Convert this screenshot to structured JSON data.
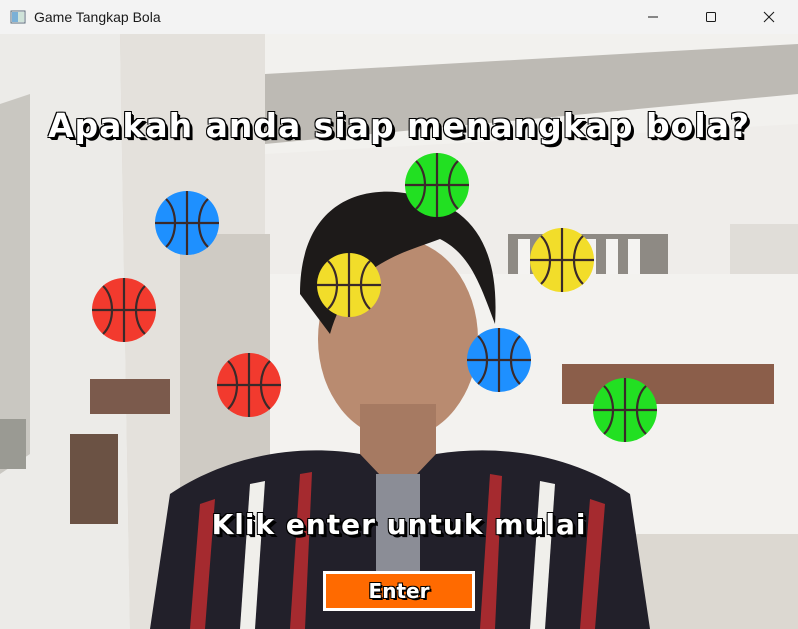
{
  "window": {
    "title": "Game Tangkap Bola",
    "controls": {
      "minimize_icon": "minimize-icon",
      "maximize_icon": "maximize-icon",
      "close_icon": "close-icon"
    }
  },
  "game": {
    "headline": "Apakah anda siap menangkap bola?",
    "instruction": "Klik enter untuk mulai",
    "enter_button_label": "Enter",
    "colors": {
      "button": "#ff6a00",
      "text": "#ffffff",
      "text_outline": "#000000"
    },
    "balls": [
      {
        "color": "blue",
        "fill": "#1e90ff"
      },
      {
        "color": "green",
        "fill": "#22e022"
      },
      {
        "color": "yellow",
        "fill": "#f2dd2a"
      },
      {
        "color": "yellow",
        "fill": "#f2dd2a"
      },
      {
        "color": "red",
        "fill": "#f23a2e"
      },
      {
        "color": "blue",
        "fill": "#1e90ff"
      },
      {
        "color": "red",
        "fill": "#f23a2e"
      },
      {
        "color": "green",
        "fill": "#22e022"
      }
    ]
  }
}
